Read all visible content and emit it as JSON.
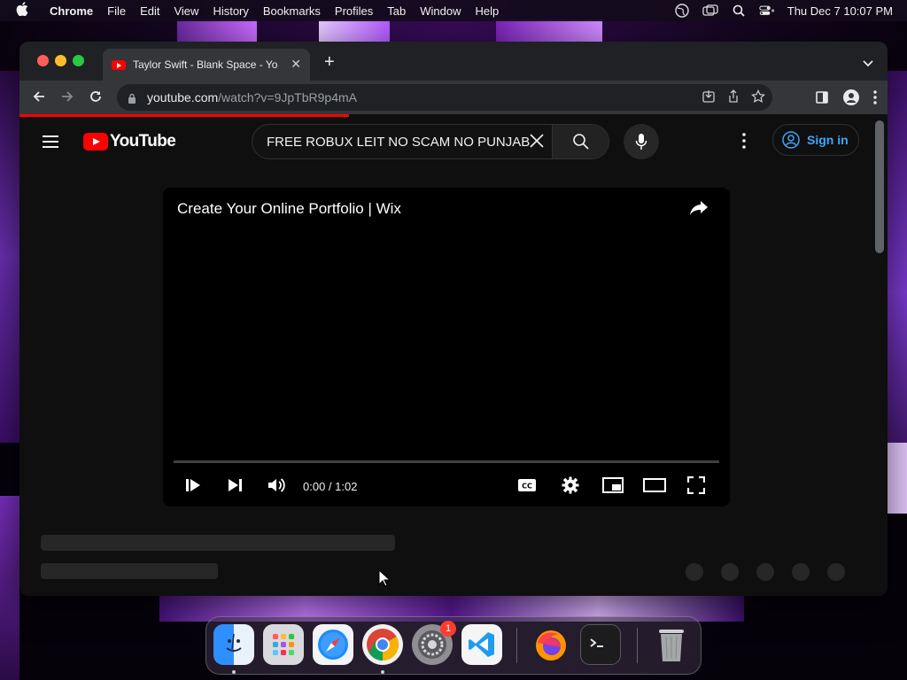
{
  "menubar": {
    "app_name": "Chrome",
    "items": [
      "File",
      "Edit",
      "View",
      "History",
      "Bookmarks",
      "Profiles",
      "Tab",
      "Window",
      "Help"
    ],
    "datetime": "Thu Dec 7  10:07 PM"
  },
  "browser": {
    "tab_title": "Taylor Swift - Blank Space - Yo",
    "url_host": "youtube.com",
    "url_path": "/watch?v=9JpTbR9p4mA",
    "load_progress": 0.38
  },
  "youtube": {
    "logo_text": "YouTube",
    "search_value": "FREE ROBUX LEIT NO SCAM NO PUNJAB",
    "signin_label": "Sign in",
    "player": {
      "video_title": "Create Your Online Portfolio | Wix",
      "time": "0:00 / 1:02",
      "progress": 0
    }
  },
  "dock": {
    "items": [
      {
        "name": "Finder",
        "icon": "finder-icon",
        "running": true
      },
      {
        "name": "Launchpad",
        "icon": "launchpad-icon",
        "running": false
      },
      {
        "name": "Safari",
        "icon": "safari-icon",
        "running": false
      },
      {
        "name": "Chrome",
        "icon": "chrome-icon",
        "running": true
      },
      {
        "name": "System Settings",
        "icon": "settings-icon",
        "running": false,
        "badge": "1"
      },
      {
        "name": "Visual Studio Code",
        "icon": "vscode-icon",
        "running": false
      },
      {
        "name": "Firefox",
        "icon": "firefox-icon",
        "running": false
      },
      {
        "name": "Terminal",
        "icon": "terminal-icon",
        "running": false
      },
      {
        "name": "Trash",
        "icon": "trash-icon",
        "running": false
      }
    ],
    "settings_badge": "1"
  }
}
